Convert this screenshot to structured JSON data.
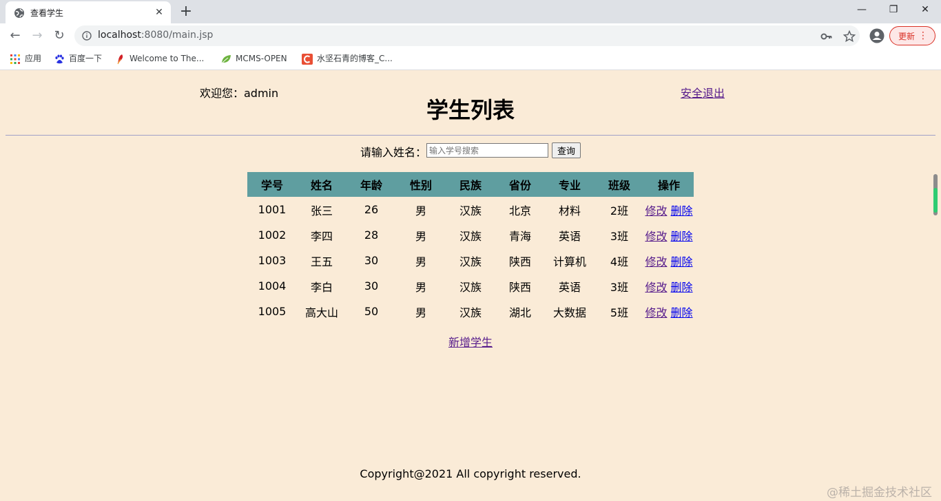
{
  "browser": {
    "tab_title": "查看学生",
    "url_host": "localhost",
    "url_rest": ":8080/main.jsp",
    "update_label": "更新",
    "bookmarks": [
      {
        "label": "应用",
        "icon": "apps-grid-icon"
      },
      {
        "label": "百度一下",
        "icon": "baidu-paw-icon"
      },
      {
        "label": "Welcome to The...",
        "icon": "feather-icon"
      },
      {
        "label": "MCMS-OPEN",
        "icon": "leaf-icon"
      },
      {
        "label": "水坚石青的博客_C...",
        "icon": "csdn-c-icon"
      }
    ]
  },
  "page": {
    "welcome": "欢迎您：admin",
    "logout": "安全退出",
    "title": "学生列表",
    "search_label": "请输入姓名：",
    "search_placeholder": "输入学号搜索",
    "search_button": "查询",
    "table": {
      "headers": [
        "学号",
        "姓名",
        "年龄",
        "性别",
        "民族",
        "省份",
        "专业",
        "班级",
        "操作"
      ],
      "rows": [
        [
          "1001",
          "张三",
          "26",
          "男",
          "汉族",
          "北京",
          "材料",
          "2班"
        ],
        [
          "1002",
          "李四",
          "28",
          "男",
          "汉族",
          "青海",
          "英语",
          "3班"
        ],
        [
          "1003",
          "王五",
          "30",
          "男",
          "汉族",
          "陕西",
          "计算机",
          "4班"
        ],
        [
          "1004",
          "李白",
          "30",
          "男",
          "汉族",
          "陕西",
          "英语",
          "3班"
        ],
        [
          "1005",
          "高大山",
          "50",
          "男",
          "汉族",
          "湖北",
          "大数据",
          "5班"
        ]
      ],
      "edit_label": "修改",
      "delete_label": "删除"
    },
    "add_student": "新增学生",
    "copyright": "Copyright@2021 All copyright reserved.",
    "watermark": "@稀土掘金技术社区"
  },
  "colors": {
    "page_background": "#faebd7",
    "table_header": "#5f9ea0",
    "visited_link": "#551a8b",
    "link": "#0000ee"
  }
}
